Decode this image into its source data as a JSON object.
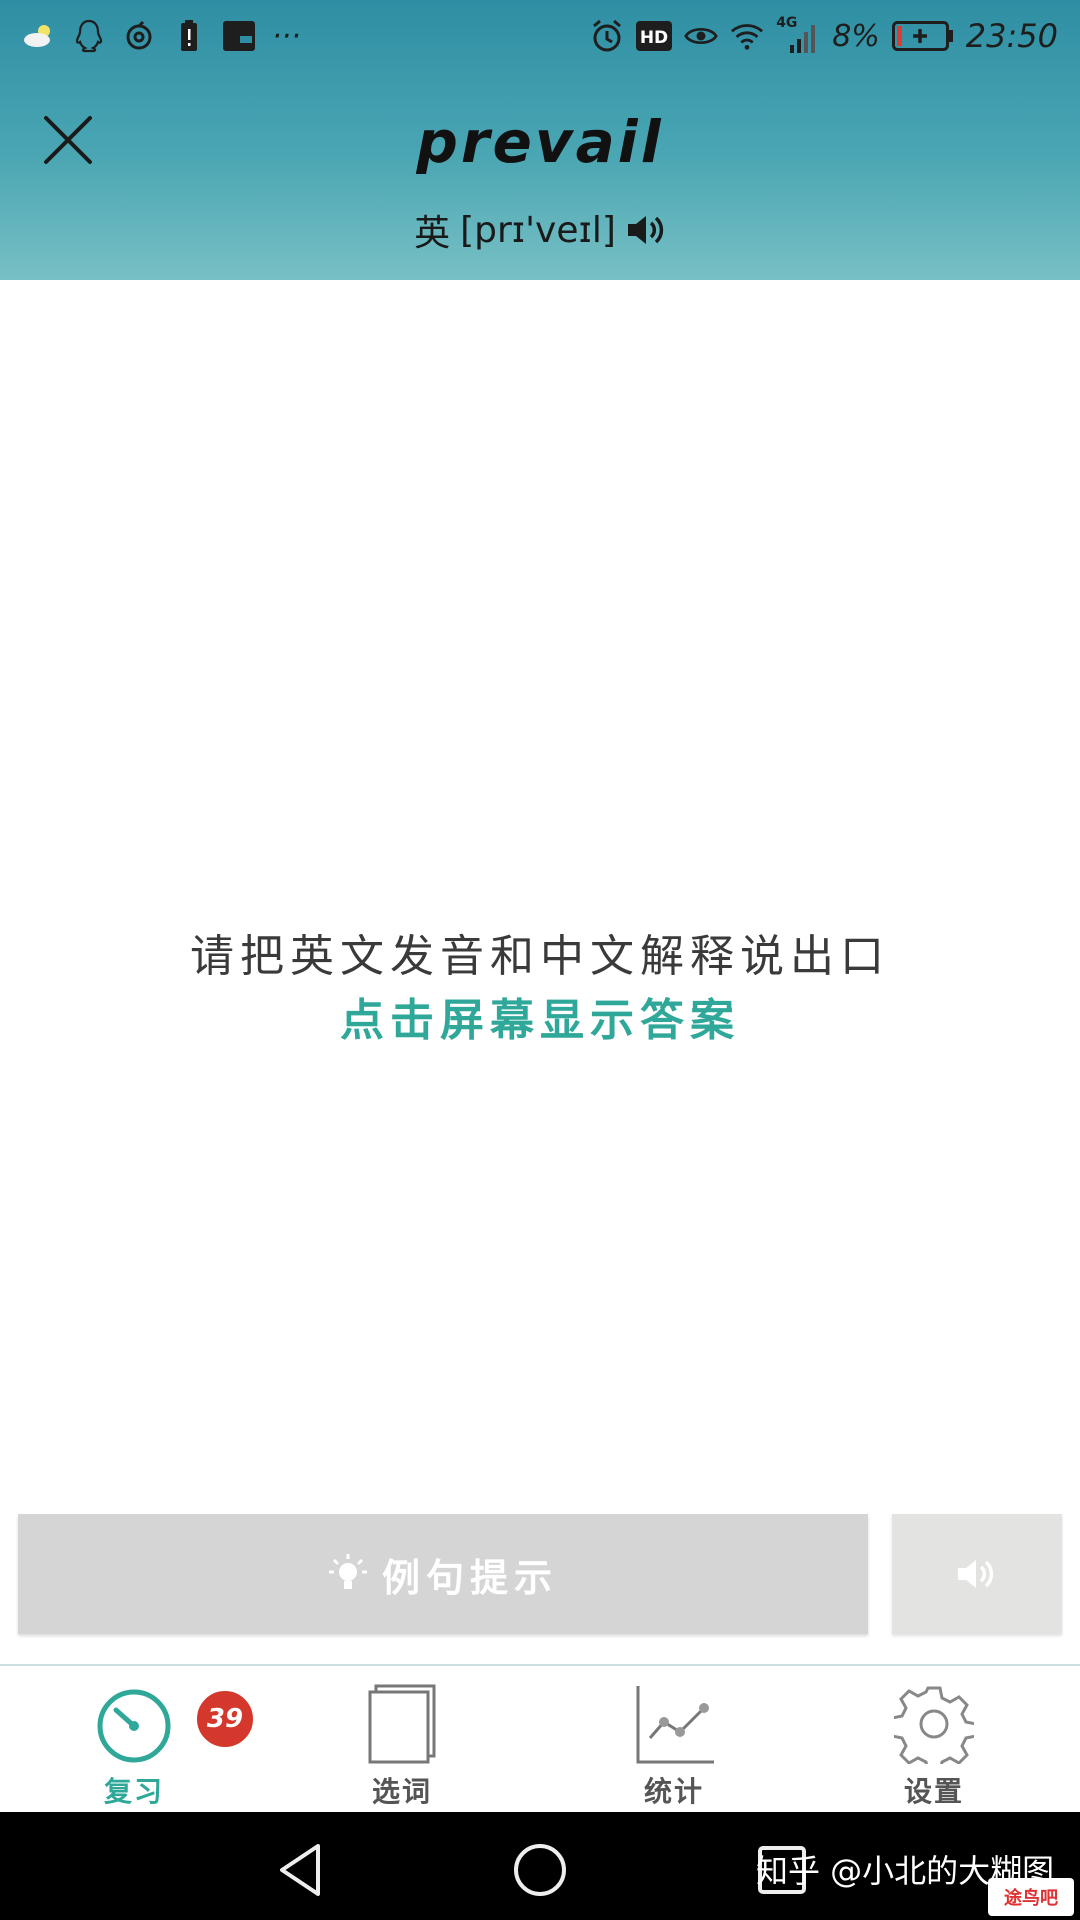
{
  "status_bar": {
    "battery_pct": "8%",
    "time": "23:50",
    "network": "4G",
    "hd": "HD",
    "more": "···",
    "icons": [
      "weather-icon",
      "qq-icon",
      "netease-icon",
      "battery-alert-icon",
      "wallet-icon",
      "alarm-icon",
      "hd-icon",
      "eye-icon",
      "wifi-icon",
      "signal-icon",
      "battery-icon"
    ]
  },
  "header": {
    "word": "prevail",
    "phonetic_label": "英",
    "phonetic": "[prɪ'veɪl]",
    "close_icon": "close-icon",
    "speaker_icon": "speaker-icon"
  },
  "prompt": {
    "instruction": "请把英文发音和中文解释说出口",
    "tap_hint": "点击屏幕显示答案"
  },
  "actions": {
    "hint_label": "例句提示",
    "hint_icon": "lightbulb-icon",
    "audio_icon": "speaker-icon"
  },
  "tabs": [
    {
      "label": "复习",
      "icon": "review-dial-icon",
      "badge": "39",
      "active": true
    },
    {
      "label": "选词",
      "icon": "book-icon",
      "active": false
    },
    {
      "label": "统计",
      "icon": "line-chart-icon",
      "active": false
    },
    {
      "label": "设置",
      "icon": "gear-icon",
      "active": false
    }
  ],
  "nav": {
    "back_icon": "back-triangle-icon",
    "home_icon": "home-circle-icon",
    "recents_icon": "recents-square-icon"
  },
  "watermark": {
    "text": "知乎 @小北的大糊图",
    "logo_text": "途鸟吧"
  },
  "colors": {
    "accent": "#2fa89a",
    "header_top": "#2e8ea3",
    "header_bottom": "#78c0c5",
    "badge": "#d4382c"
  }
}
